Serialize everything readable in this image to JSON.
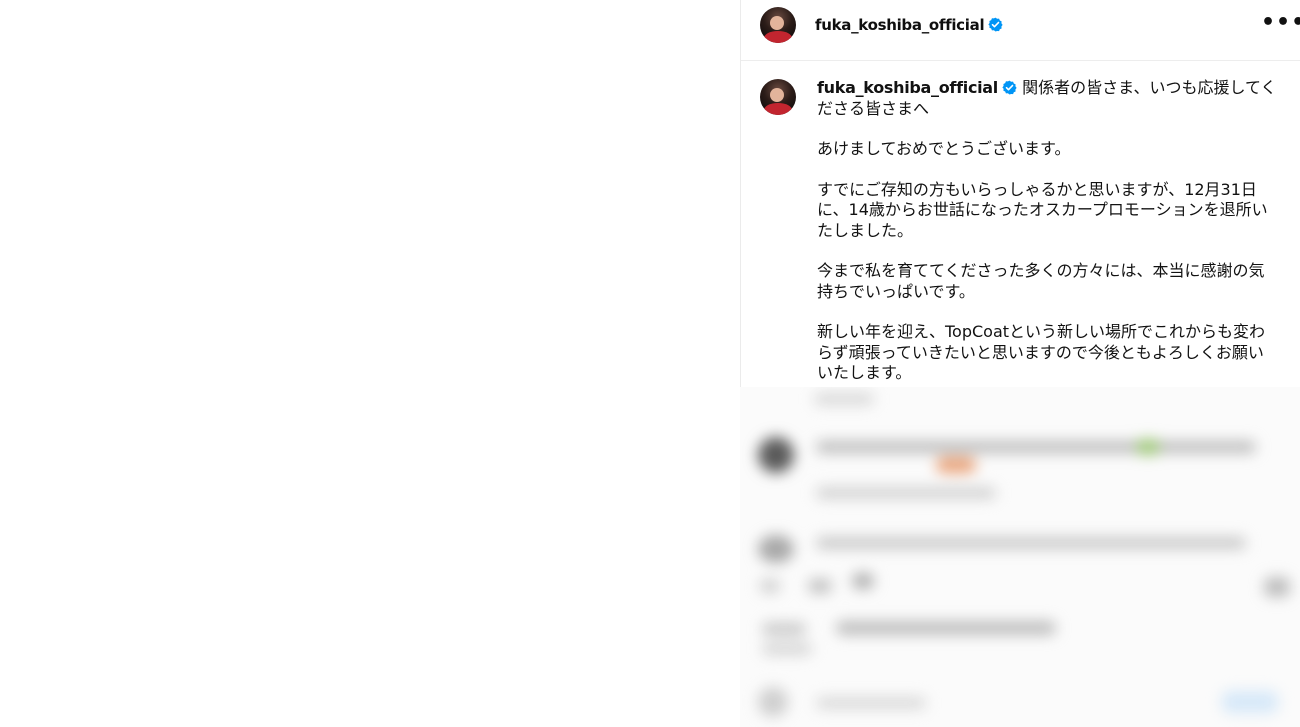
{
  "post": {
    "username": "fuka_koshiba_official",
    "verified": true,
    "more_icon": "•••",
    "caption": {
      "username": "fuka_koshiba_official",
      "lines": [
        "関係者の皆さま、いつも応援してくださる皆さまへ",
        "",
        "あけましておめでとうございます。",
        "",
        "すでにご存知の方もいらっしゃるかと思いますが、12月31日に、14歳からお世話になったオスカープロモーションを退所いたしました。",
        "",
        "今まで私を育ててくださった多くの方々には、本当に感謝の気持ちでいっぱいです。",
        "",
        "新しい年を迎え、TopCoatという新しい場所でこれからも変わらず頑張っていきたいと思いますので今後ともよろしくお願いいたします。"
      ]
    }
  },
  "colors": {
    "verified_badge": "#0095f6",
    "text": "#121212",
    "divider": "#ededed"
  }
}
